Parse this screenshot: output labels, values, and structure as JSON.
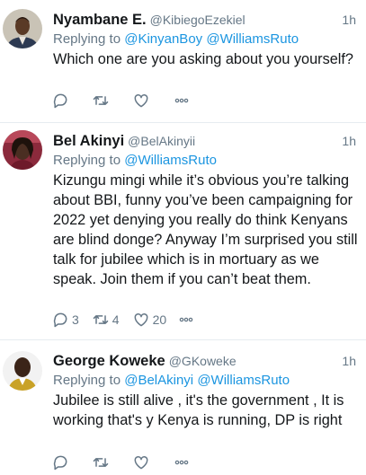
{
  "tweets": [
    {
      "name": "Nyambane E.",
      "handle": "@KibiegoEzekiel",
      "time": "1h",
      "replying_prefix": "Replying to ",
      "mentions": [
        "@KinyanBoy",
        "@WilliamsRuto"
      ],
      "text": "Which one are you asking about you yourself?",
      "reply_count": "",
      "retweet_count": "",
      "like_count": ""
    },
    {
      "name": "Bel Akinyi",
      "handle": "@BelAkinyii",
      "time": "1h",
      "replying_prefix": "Replying to ",
      "mentions": [
        "@WilliamsRuto"
      ],
      "text": "Kizungu mingi while it’s obvious you’re talking about BBI, funny you’ve been campaigning for 2022 yet denying you really do think Kenyans are blind donge? Anyway I’m surprised you still talk for jubilee which is in mortuary as we speak. Join them if you can’t beat them.",
      "reply_count": "3",
      "retweet_count": "4",
      "like_count": "20"
    },
    {
      "name": "George Koweke",
      "handle": "@GKoweke",
      "time": "1h",
      "replying_prefix": "Replying to ",
      "mentions": [
        "@BelAkinyi",
        "@WilliamsRuto"
      ],
      "text": "Jubilee is still alive , it's the government , It is working that's y Kenya is running, DP is right",
      "reply_count": "",
      "retweet_count": "",
      "like_count": ""
    }
  ],
  "icons": {
    "reply": "reply-icon",
    "retweet": "retweet-icon",
    "like": "like-icon",
    "more": "more-icon"
  },
  "colors": {
    "link": "#1b95e0",
    "muted": "#657786",
    "divider": "#e6ecf0"
  }
}
